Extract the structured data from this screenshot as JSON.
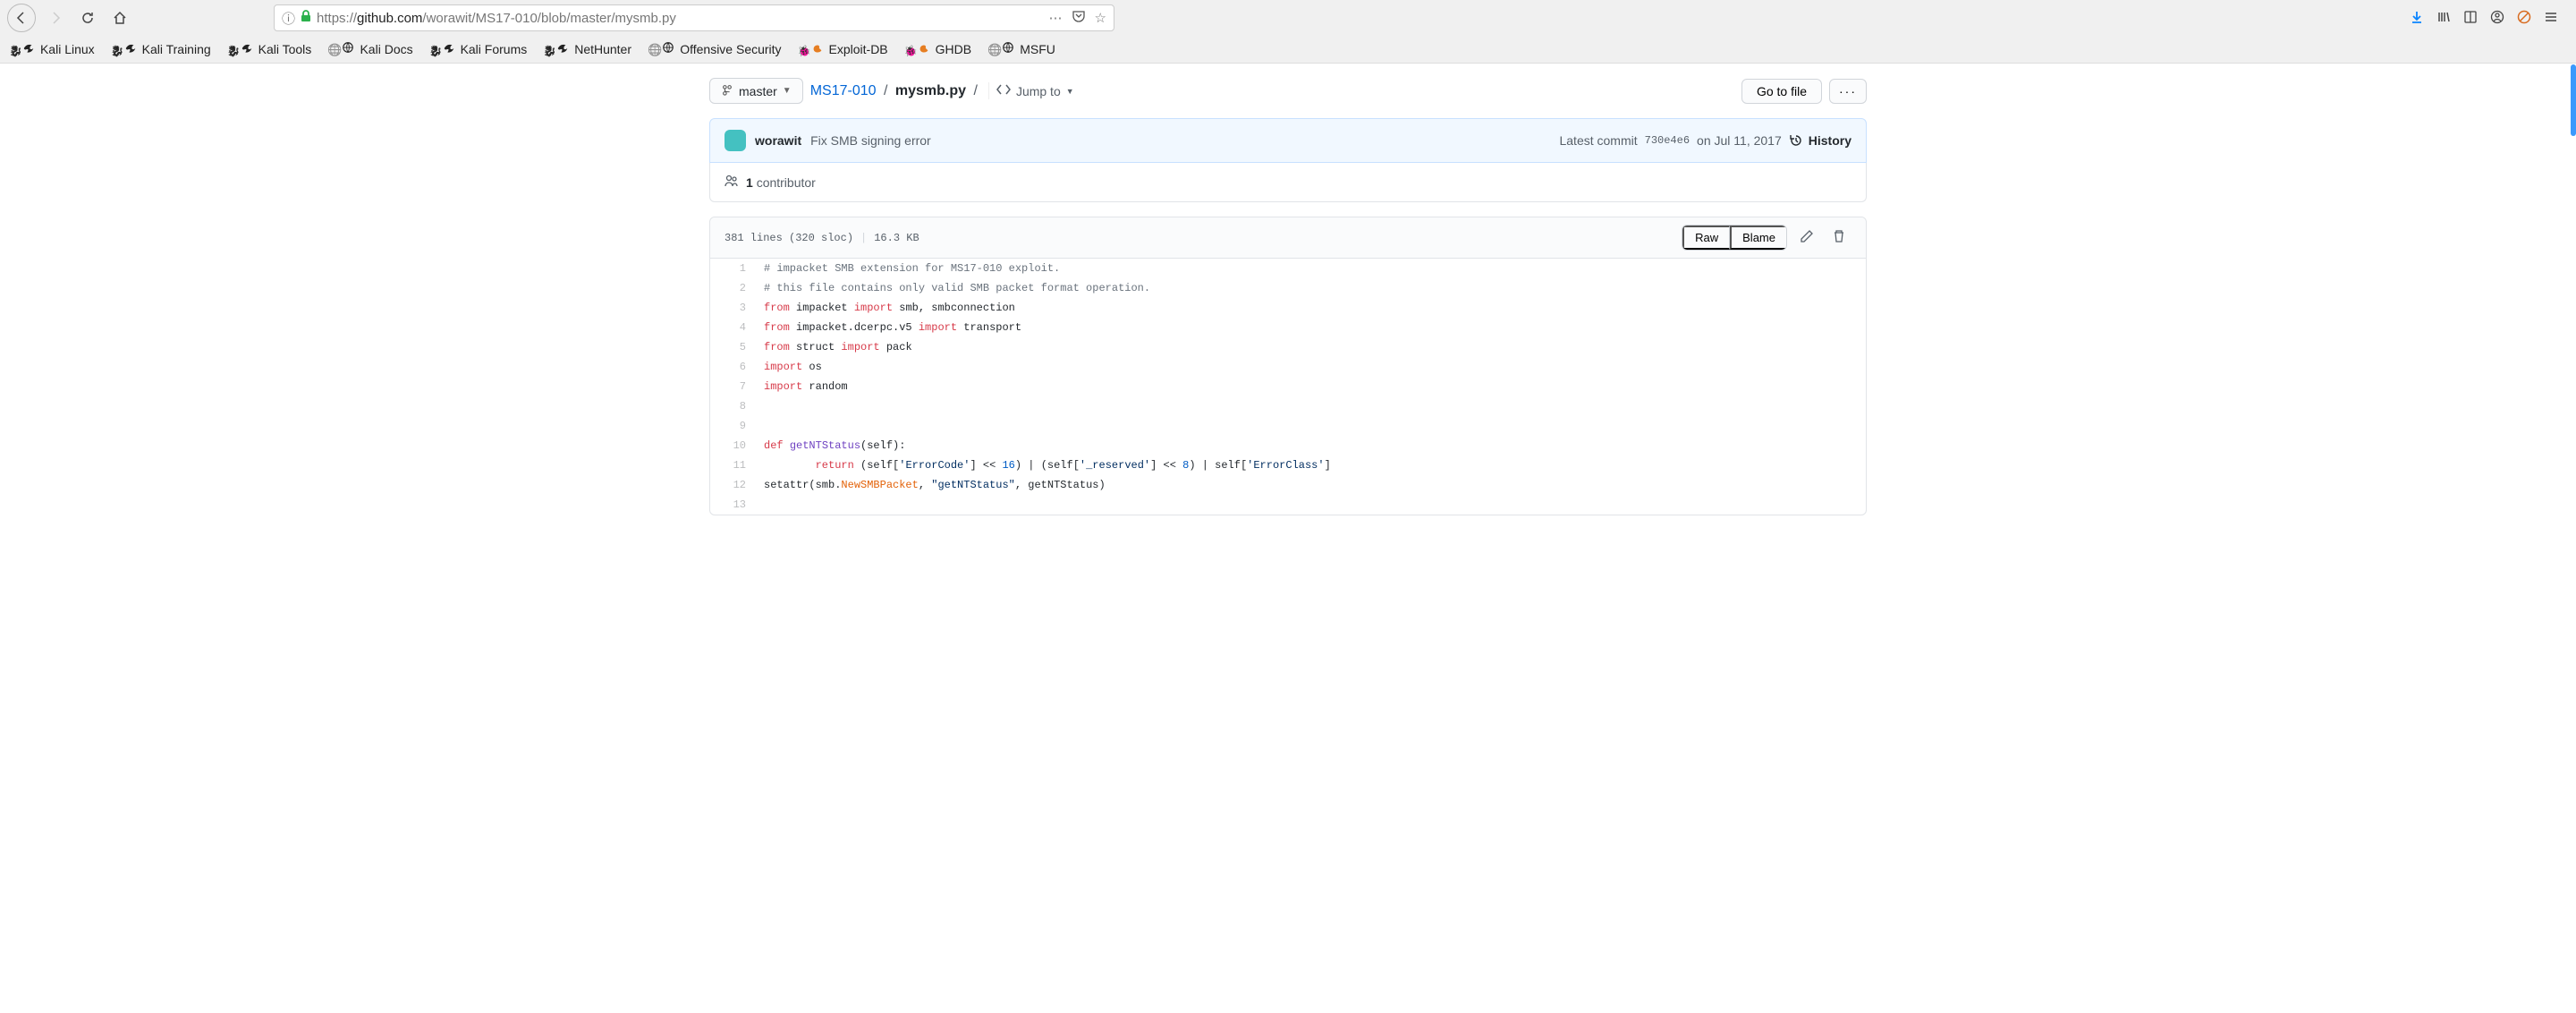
{
  "browser": {
    "url_prefix": "https://",
    "url_host": "github.com",
    "url_path": "/worawit/MS17-010/blob/master/mysmb.py",
    "bookmarks": [
      {
        "label": "Kali Linux",
        "icon": "dragon"
      },
      {
        "label": "Kali Training",
        "icon": "dragon"
      },
      {
        "label": "Kali Tools",
        "icon": "dragon"
      },
      {
        "label": "Kali Docs",
        "icon": "globe"
      },
      {
        "label": "Kali Forums",
        "icon": "dragon"
      },
      {
        "label": "NetHunter",
        "icon": "dragon"
      },
      {
        "label": "Offensive Security",
        "icon": "globe"
      },
      {
        "label": "Exploit-DB",
        "icon": "bug"
      },
      {
        "label": "GHDB",
        "icon": "bug"
      },
      {
        "label": "MSFU",
        "icon": "globe"
      }
    ]
  },
  "repo": {
    "branch": "master",
    "breadcrumb_repo": "MS17-010",
    "breadcrumb_file": "mysmb.py",
    "jump_to": "Jump to",
    "go_to_file": "Go to file"
  },
  "commit": {
    "author": "worawit",
    "message": "Fix SMB signing error",
    "latest_commit_label": "Latest commit",
    "sha": "730e4e6",
    "date_prefix": "on",
    "date": "Jul 11, 2017",
    "history": "History"
  },
  "contributors": {
    "count": "1",
    "label": "contributor"
  },
  "file": {
    "lines_text": "381 lines (320 sloc)",
    "size": "16.3 KB",
    "raw": "Raw",
    "blame": "Blame"
  },
  "code": {
    "lines": [
      {
        "n": "1",
        "html": "<span class='pl-c'># impacket SMB extension for MS17-010 exploit.</span>"
      },
      {
        "n": "2",
        "html": "<span class='pl-c'># this file contains only valid SMB packet format operation.</span>"
      },
      {
        "n": "3",
        "html": "<span class='pl-k'>from</span> impacket <span class='pl-k'>import</span> smb, smbconnection"
      },
      {
        "n": "4",
        "html": "<span class='pl-k'>from</span> impacket.dcerpc.v5 <span class='pl-k'>import</span> transport"
      },
      {
        "n": "5",
        "html": "<span class='pl-k'>from</span> struct <span class='pl-k'>import</span> pack"
      },
      {
        "n": "6",
        "html": "<span class='pl-k'>import</span> os"
      },
      {
        "n": "7",
        "html": "<span class='pl-k'>import</span> random"
      },
      {
        "n": "8",
        "html": ""
      },
      {
        "n": "9",
        "html": ""
      },
      {
        "n": "10",
        "html": "<span class='pl-k'>def</span> <span class='pl-en'>getNTStatus</span>(self):"
      },
      {
        "n": "11",
        "html": "        <span class='pl-k'>return</span> (self[<span class='pl-s'>'ErrorCode'</span>] &lt;&lt; <span class='pl-c1'>16</span>) | (self[<span class='pl-s'>'_reserved'</span>] &lt;&lt; <span class='pl-c1'>8</span>) | self[<span class='pl-s'>'ErrorClass'</span>]"
      },
      {
        "n": "12",
        "html": "setattr(smb.<span class='pl-e'>NewSMBPacket</span>, <span class='pl-s'>\"getNTStatus\"</span>, getNTStatus)"
      },
      {
        "n": "13",
        "html": ""
      }
    ]
  }
}
